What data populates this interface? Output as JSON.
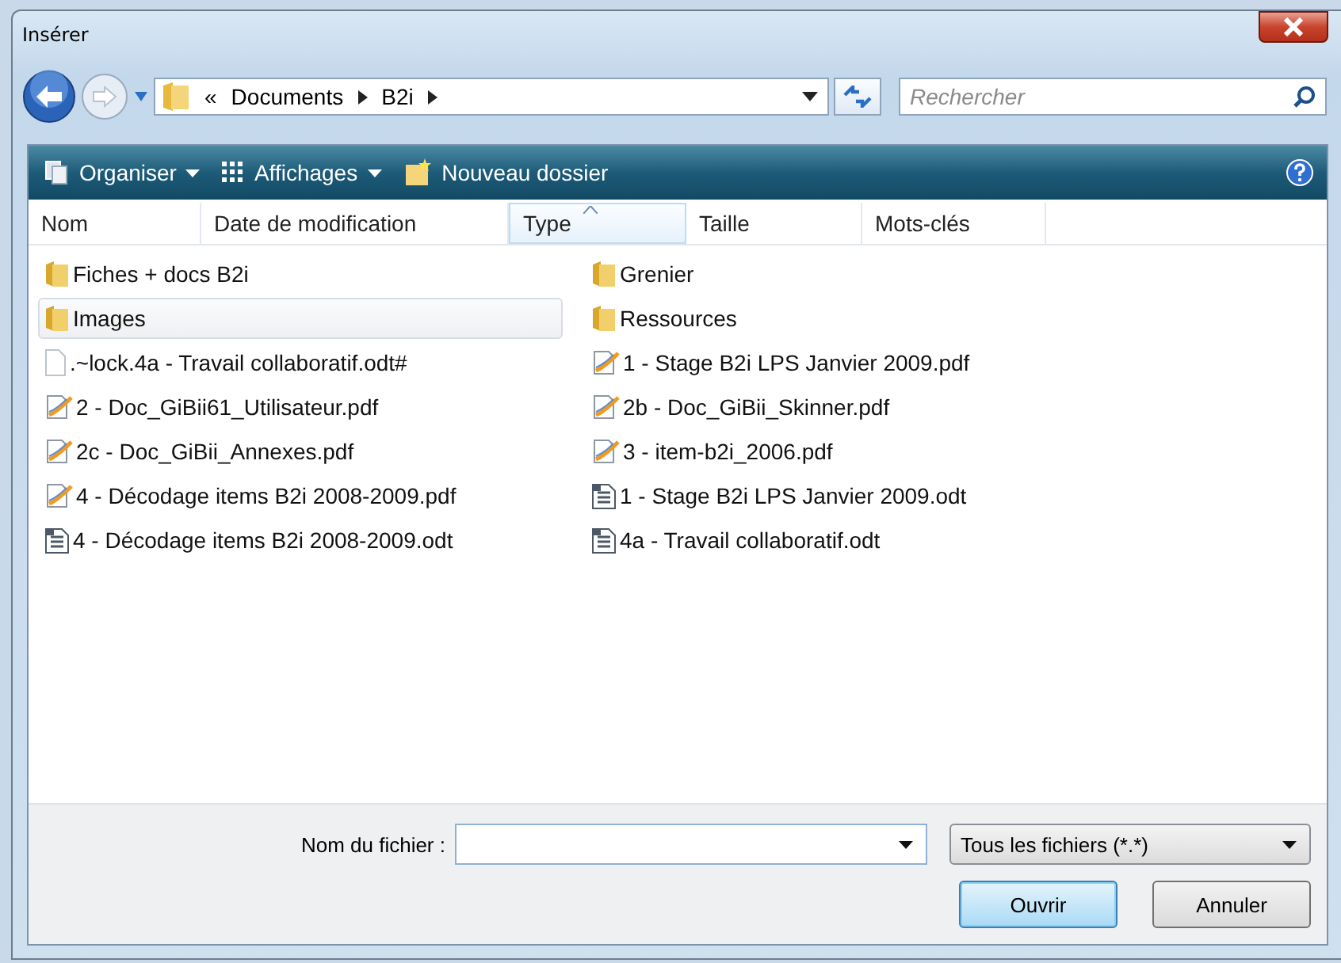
{
  "window": {
    "title": "Insérer"
  },
  "address": {
    "overflow": "«",
    "crumbs": [
      "Documents",
      "B2i"
    ]
  },
  "search": {
    "placeholder": "Rechercher"
  },
  "toolbar": [
    {
      "label": "Organiser",
      "kind": "organize"
    },
    {
      "label": "Affichages",
      "kind": "views"
    },
    {
      "label": "Nouveau dossier",
      "kind": "newfolder"
    }
  ],
  "columns": [
    {
      "label": "Nom",
      "sorted": false
    },
    {
      "label": "Date de modification",
      "sorted": false
    },
    {
      "label": "Type",
      "sorted": true
    },
    {
      "label": "Taille",
      "sorted": false
    },
    {
      "label": "Mots-clés",
      "sorted": false
    }
  ],
  "files": [
    {
      "name": "Fiches + docs B2i",
      "kind": "folder",
      "selected": false
    },
    {
      "name": "Images",
      "kind": "folder",
      "selected": true
    },
    {
      "name": ".~lock.4a - Travail collaboratif.odt#",
      "kind": "blank",
      "selected": false
    },
    {
      "name": "2 - Doc_GiBii61_Utilisateur.pdf",
      "kind": "pdf",
      "selected": false
    },
    {
      "name": "2c - Doc_GiBii_Annexes.pdf",
      "kind": "pdf",
      "selected": false
    },
    {
      "name": "4 - Décodage items B2i 2008-2009.pdf",
      "kind": "pdf",
      "selected": false
    },
    {
      "name": "4 - Décodage items B2i 2008-2009.odt",
      "kind": "odt",
      "selected": false
    },
    {
      "name": "Grenier",
      "kind": "folder",
      "selected": false
    },
    {
      "name": "Ressources",
      "kind": "folder",
      "selected": false
    },
    {
      "name": "1 - Stage B2i LPS Janvier 2009.pdf",
      "kind": "pdf",
      "selected": false
    },
    {
      "name": "2b - Doc_GiBii_Skinner.pdf",
      "kind": "pdf",
      "selected": false
    },
    {
      "name": "3 - item-b2i_2006.pdf",
      "kind": "pdf",
      "selected": false
    },
    {
      "name": "1 - Stage B2i LPS Janvier 2009.odt",
      "kind": "odt",
      "selected": false
    },
    {
      "name": "4a - Travail collaboratif.odt",
      "kind": "odt",
      "selected": false
    }
  ],
  "filename": {
    "label": "Nom du fichier :"
  },
  "filetype": {
    "value": "Tous les fichiers (*.*)"
  },
  "buttons": [
    {
      "label": "Ouvrir",
      "default": true
    },
    {
      "label": "Annuler",
      "default": false
    }
  ]
}
